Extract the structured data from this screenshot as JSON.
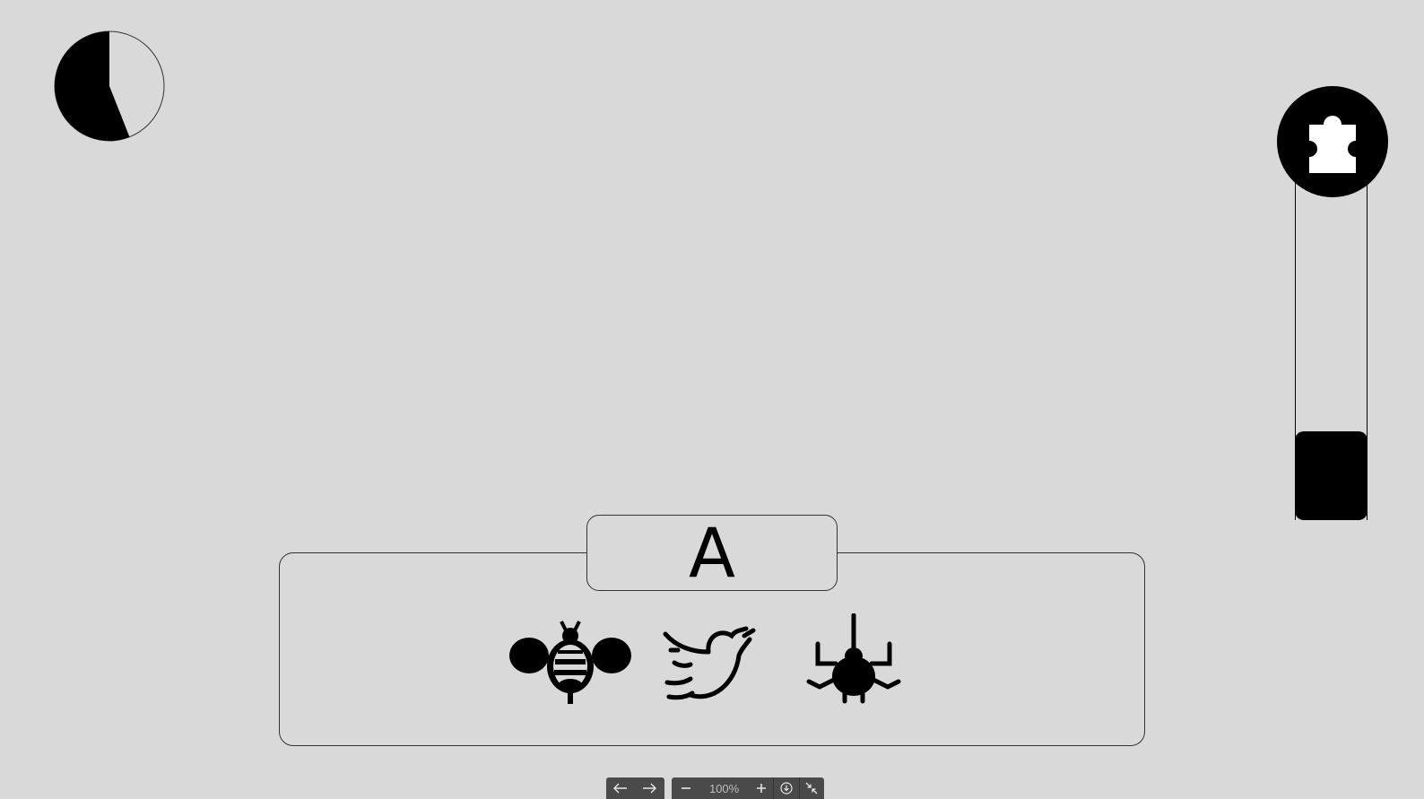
{
  "timer": {
    "elapsed_fraction": 0.56
  },
  "progress": {
    "value": 0.26,
    "icon": "puzzle-icon"
  },
  "card": {
    "letter": "A",
    "choices": [
      {
        "icon": "bee-icon"
      },
      {
        "icon": "bird-icon"
      },
      {
        "icon": "spider-icon"
      }
    ]
  },
  "toolbar": {
    "zoom_label": "100%",
    "icons": [
      "arrow-left-icon",
      "arrow-right-icon",
      "minus-icon",
      "plus-icon",
      "download-icon",
      "collapse-icon"
    ]
  }
}
